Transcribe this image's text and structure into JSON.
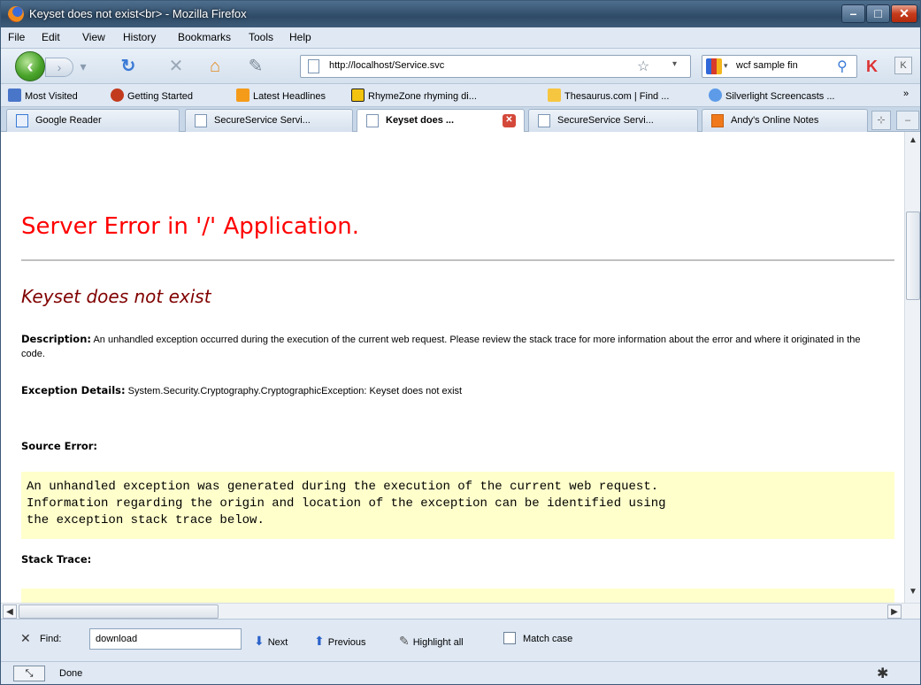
{
  "window": {
    "title": "Keyset does not exist<br> - Mozilla Firefox"
  },
  "menu": [
    "File",
    "Edit",
    "View",
    "History",
    "Bookmarks",
    "Tools",
    "Help"
  ],
  "nav": {
    "url": "http://localhost/Service.svc",
    "search_value": "wcf sample fin"
  },
  "bookmarks": [
    {
      "label": "Most Visited",
      "color": "#4a76c9"
    },
    {
      "label": "Getting Started",
      "color": "#c23b1e"
    },
    {
      "label": "Latest Headlines",
      "color": "#f59b1a"
    },
    {
      "label": "RhymeZone rhyming di...",
      "color": "#f2c30f"
    },
    {
      "label": "Thesaurus.com | Find ...",
      "color": "#f7c640"
    },
    {
      "label": "Silverlight Screencasts ...",
      "color": "#5d9be8"
    }
  ],
  "bookmarks_more": "»",
  "tabs": [
    {
      "label": "Google Reader",
      "active": false
    },
    {
      "label": "SecureService Servi...",
      "active": false
    },
    {
      "label": "Keyset does ...",
      "active": true
    },
    {
      "label": "SecureService Servi...",
      "active": false
    },
    {
      "label": "Andy's Online Notes",
      "active": false
    }
  ],
  "page": {
    "error_title": "Server Error in '/' Application.",
    "error_sub": "Keyset does not exist",
    "desc_label": "Description:",
    "desc_text": "An unhandled exception occurred during the execution of the current web request. Please review the stack trace for more information about the error and where it originated in the code.",
    "exc_label": "Exception Details:",
    "exc_text": "System.Security.Cryptography.CryptographicException: Keyset does not exist",
    "source_error": "Source Error:",
    "source_code": "An unhandled exception was generated during the execution of the current web request.\nInformation regarding the origin and location of the exception can be identified using\nthe exception stack trace below.",
    "stack_trace": "Stack Trace:"
  },
  "find": {
    "label": "Find:",
    "value": "download",
    "next": "Next",
    "previous": "Previous",
    "highlight": "Highlight all",
    "match_case": "Match case"
  },
  "status": {
    "text": "Done"
  }
}
